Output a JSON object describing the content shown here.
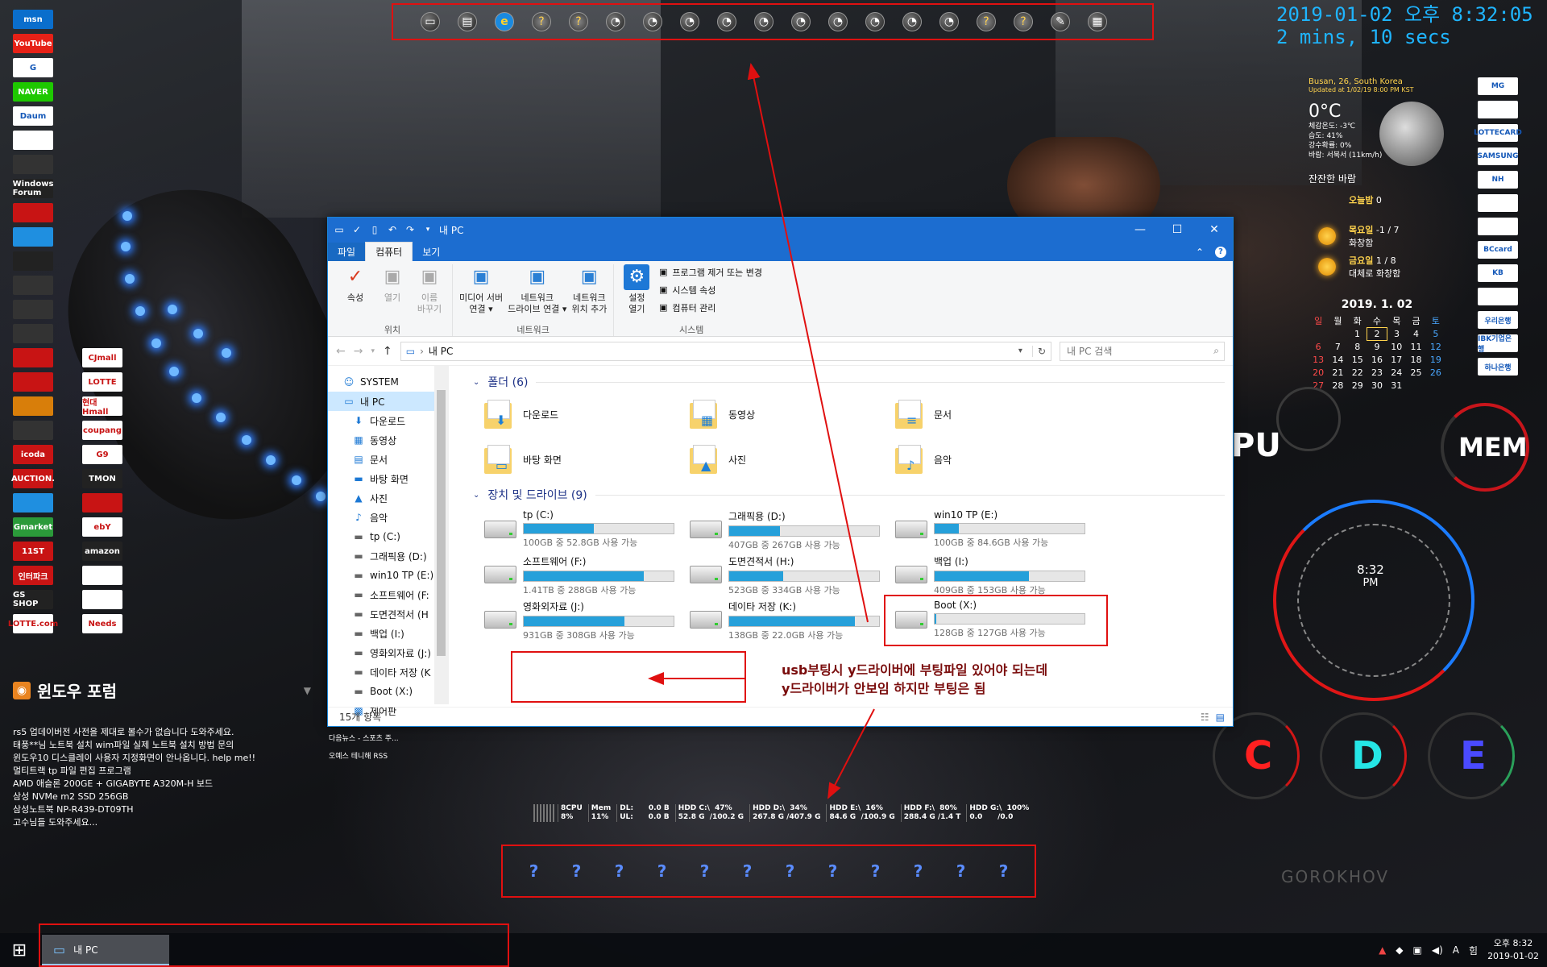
{
  "top_launcher": {
    "icons": [
      "desktop-icon",
      "folder-icon",
      "ie-icon",
      "help-icon",
      "help-icon",
      "app-icon",
      "app-icon",
      "app-icon",
      "app-icon",
      "app-icon",
      "app-icon",
      "app-icon",
      "app-icon",
      "app-icon",
      "app-icon",
      "help-icon",
      "help-icon",
      "pencil-icon",
      "calendar-icon"
    ]
  },
  "clock": {
    "datetime": "2019-01-02 오후 8:32:05",
    "uptime": "2 mins, 10 secs"
  },
  "left_icons": [
    "msn",
    "YouTube",
    "G",
    "NAVER",
    "Daum",
    "",
    "",
    "Windows Forum",
    "",
    "",
    "",
    "",
    "",
    ""
  ],
  "left_grid": [
    "",
    "CJmall",
    "",
    "LOTTE",
    "",
    "현대Hmall",
    "",
    "coupang",
    "icoda",
    "G9",
    "AUCTION.",
    "TMON",
    "",
    "",
    "Gmarket",
    "ebY",
    "11ST",
    "amazon",
    "인터파크",
    "",
    "GS SHOP",
    "",
    "LOTTE.com",
    "Needs"
  ],
  "right_icons": [
    "MG",
    "",
    "LOTTECARD",
    "SAMSUNG",
    "NH",
    "",
    "",
    "BCcard",
    "KB",
    "",
    "우리은행",
    "IBK기업은행",
    "하나은행"
  ],
  "weather": {
    "location": "Busan, 26, South Korea",
    "updated": "Updated at 1/02/19 8:00 PM KST",
    "temp": "0°C",
    "details": [
      "체감온도: -3℃",
      "습도: 41%",
      "강수확률: 0%",
      "바람: 서북서 (11km/h)"
    ],
    "condition": "잔잔한 바람",
    "today_label": "오늘밤",
    "today_val": "0",
    "day1": "목요일",
    "day1_temp": "-1 / 7",
    "day1_cond": "화창함",
    "day2": "금요일",
    "day2_temp": "1 / 8",
    "day2_cond": "대체로 화창함"
  },
  "calendar": {
    "title": "2019. 1. 02",
    "weekdays": [
      "일",
      "월",
      "화",
      "수",
      "목",
      "금",
      "토"
    ],
    "weeks": [
      [
        "",
        "",
        "1",
        "2",
        "3",
        "4",
        "5"
      ],
      [
        "6",
        "7",
        "8",
        "9",
        "10",
        "11",
        "12"
      ],
      [
        "13",
        "14",
        "15",
        "16",
        "17",
        "18",
        "19"
      ],
      [
        "20",
        "21",
        "22",
        "23",
        "24",
        "25",
        "26"
      ],
      [
        "27",
        "28",
        "29",
        "30",
        "31",
        "",
        ""
      ]
    ],
    "today": "2"
  },
  "gauges": {
    "cpu": "PU",
    "mem": "MEM",
    "time": "8:32",
    "ampm": "PM",
    "drives": [
      "C",
      "D",
      "E"
    ]
  },
  "explorer": {
    "title": "내 PC",
    "tabs": [
      "파일",
      "컴퓨터",
      "보기"
    ],
    "active_tab": "컴퓨터",
    "ribbon": {
      "location_group": "위치",
      "location": [
        {
          "label": "속성",
          "icon": "properties-icon"
        },
        {
          "label": "열기",
          "icon": "open-icon"
        },
        {
          "label": "이름\n바꾸기",
          "icon": "rename-icon"
        }
      ],
      "network_group": "네트워크",
      "network": [
        {
          "label": "미디어 서버\n연결 ▾",
          "icon": "media-server-icon"
        },
        {
          "label": "네트워크\n드라이브 연결 ▾",
          "icon": "map-drive-icon"
        },
        {
          "label": "네트워크\n위치 추가",
          "icon": "network-location-icon"
        }
      ],
      "system_group": "시스템",
      "settings": "설정\n열기",
      "system_items": [
        "프로그램 제거 또는 변경",
        "시스템 속성",
        "컴퓨터 관리"
      ]
    },
    "address": "내 PC",
    "search_placeholder": "내 PC 검색",
    "nav": [
      {
        "label": "SYSTEM",
        "icon": "user-icon"
      },
      {
        "label": "내 PC",
        "icon": "pc-icon",
        "selected": true
      },
      {
        "label": "다운로드",
        "icon": "download-icon"
      },
      {
        "label": "동영상",
        "icon": "video-icon"
      },
      {
        "label": "문서",
        "icon": "document-icon"
      },
      {
        "label": "바탕 화면",
        "icon": "desktop-icon"
      },
      {
        "label": "사진",
        "icon": "picture-icon"
      },
      {
        "label": "음악",
        "icon": "music-icon"
      },
      {
        "label": "tp (C:)",
        "icon": "drive-icon"
      },
      {
        "label": "그래픽용 (D:)",
        "icon": "drive-icon"
      },
      {
        "label": "win10 TP (E:)",
        "icon": "drive-icon"
      },
      {
        "label": "소프트웨어 (F:",
        "icon": "drive-icon"
      },
      {
        "label": "도면견적서 (H",
        "icon": "drive-icon"
      },
      {
        "label": "백업 (I:)",
        "icon": "drive-icon"
      },
      {
        "label": "영화외자료 (J:)",
        "icon": "drive-icon"
      },
      {
        "label": "데이타 저장 (K",
        "icon": "drive-icon"
      },
      {
        "label": "Boot (X:)",
        "icon": "drive-icon"
      },
      {
        "label": "제어판",
        "icon": "control-panel-icon"
      }
    ],
    "folders_header": "폴더 (6)",
    "folders": [
      {
        "label": "다운로드",
        "glyph": "⬇"
      },
      {
        "label": "동영상",
        "glyph": "▦"
      },
      {
        "label": "문서",
        "glyph": "≡"
      },
      {
        "label": "바탕 화면",
        "glyph": "▭"
      },
      {
        "label": "사진",
        "glyph": "▲"
      },
      {
        "label": "음악",
        "glyph": "♪"
      }
    ],
    "drives_header": "장치 및 드라이브 (9)",
    "drives": [
      {
        "label": "tp (C:)",
        "free": "100GB 중 52.8GB 사용 가능",
        "used_pct": 47
      },
      {
        "label": "그래픽용 (D:)",
        "free": "407GB 중 267GB 사용 가능",
        "used_pct": 34
      },
      {
        "label": "win10 TP (E:)",
        "free": "100GB 중 84.6GB 사용 가능",
        "used_pct": 16
      },
      {
        "label": "소프트웨어 (F:)",
        "free": "1.41TB 중 288GB 사용 가능",
        "used_pct": 80
      },
      {
        "label": "도면견적서 (H:)",
        "free": "523GB 중 334GB 사용 가능",
        "used_pct": 36
      },
      {
        "label": "백업 (I:)",
        "free": "409GB 중 153GB 사용 가능",
        "used_pct": 63
      },
      {
        "label": "영화외자료 (J:)",
        "free": "931GB 중 308GB 사용 가능",
        "used_pct": 67
      },
      {
        "label": "데이타 저장 (K:)",
        "free": "138GB 중 22.0GB 사용 가능",
        "used_pct": 84
      },
      {
        "label": "Boot (X:)",
        "free": "128GB 중 127GB 사용 가능",
        "used_pct": 1
      }
    ],
    "status": "15개 항목"
  },
  "annotation": {
    "line1": "usb부팅시 y드라이버에 부팅파일 있어야 되는데",
    "line2": "y드라이버가 안보임  하지만 부팅은 됨"
  },
  "forum": {
    "title": "윈도우 포럼",
    "posts": [
      "rs5 업데이버전 사전을 제대로 볼수가 없습니다 도와주세요.",
      "태풍**님 노트북 설치 wim파일 실제 노트북 설치 방법 문의",
      "윈도우10 디스클레이 사용자 지정화면이 안나옵니다. help me!!",
      "멀티트랙 tp 파일 편집 프로그램",
      "AMD 애슬론 200GE + GIGABYTE A320M-H 보드",
      "삼성 NVMe m2 SSD 256GB",
      "삼성노트북 NP-R439-DT09TH",
      "고수님들 도와주세요..."
    ],
    "side": [
      "다음뉴스 - 스포츠 주...",
      "오예스 테니해 RSS"
    ]
  },
  "sysmon": [
    {
      "a": "8CPU",
      "b": "8%"
    },
    {
      "a": "Mem",
      "b": "11%"
    },
    {
      "a": "DL:      0.0 B",
      "b": "UL:      0.0 B"
    },
    {
      "a": "HDD C:\\  47%",
      "b": "52.8 G  /100.2 G"
    },
    {
      "a": "HDD D:\\  34%",
      "b": "267.8 G /407.9 G"
    },
    {
      "a": "HDD E:\\  16%",
      "b": "84.6 G  /100.9 G"
    },
    {
      "a": "HDD F:\\  80%",
      "b": "288.4 G /1.4 T"
    },
    {
      "a": "HDD G:\\  100%",
      "b": "0.0      /0.0"
    }
  ],
  "dock": [
    "?",
    "?",
    "?",
    "?",
    "?",
    "?",
    "?",
    "?",
    "?",
    "?",
    "?",
    "?"
  ],
  "brand": "GOROKHOV",
  "taskbar": {
    "window_label": "내 PC",
    "tray_lang": "A",
    "tray_lang2": "힘",
    "time": "오후 8:32",
    "date": "2019-01-02"
  }
}
